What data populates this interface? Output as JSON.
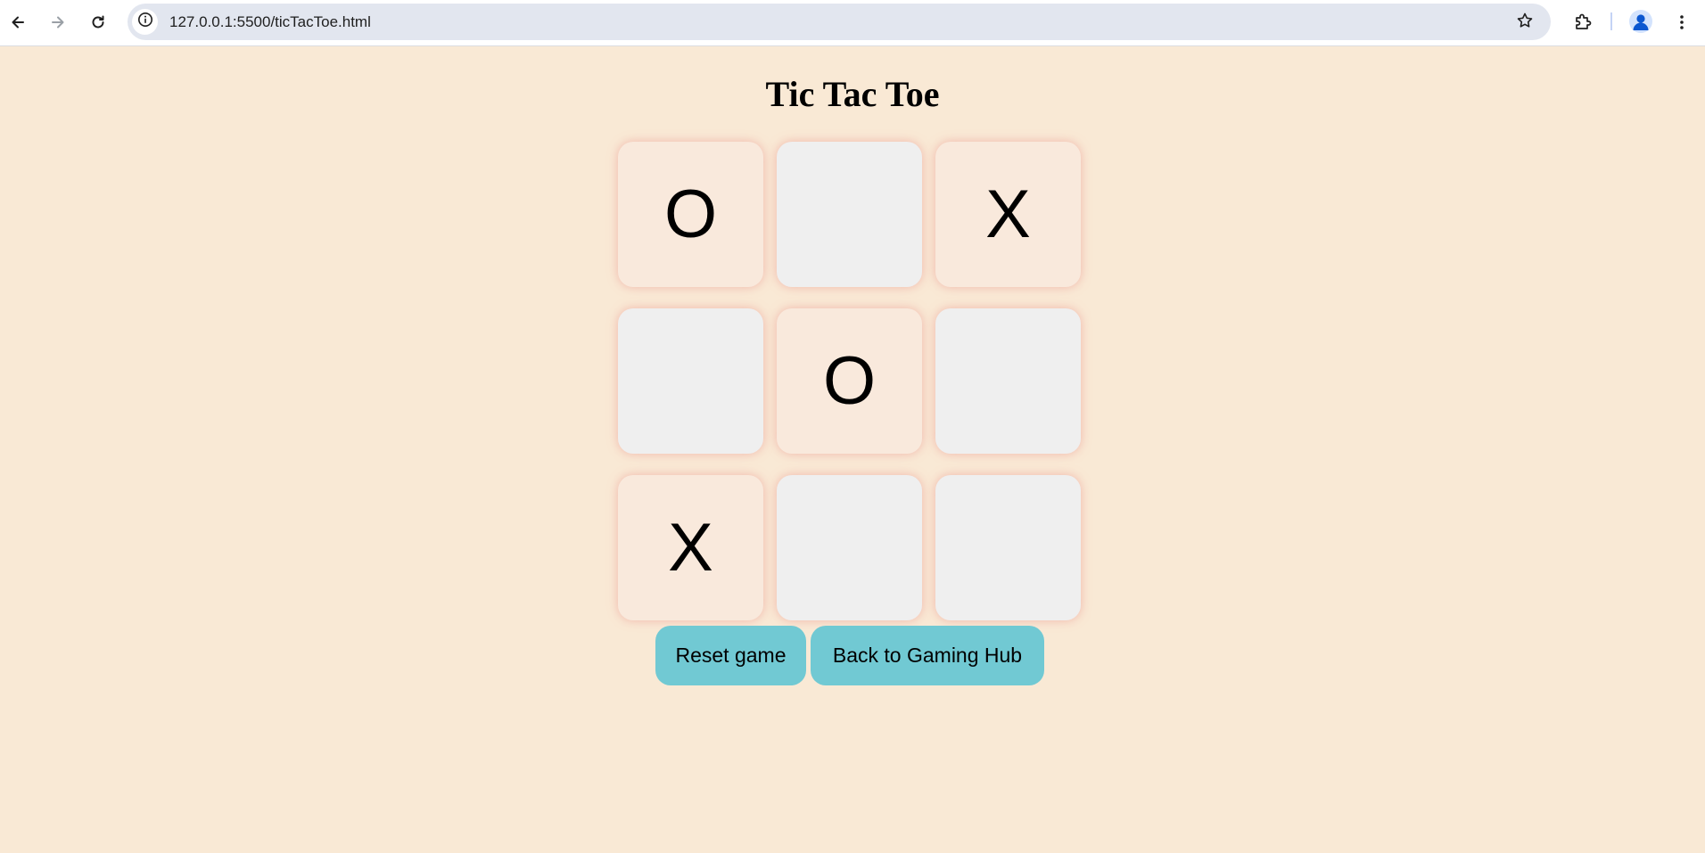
{
  "browser": {
    "url": "127.0.0.1:5500/ticTacToe.html",
    "icons": {
      "back": "arrow-left-icon",
      "forward": "arrow-right-icon",
      "reload": "reload-icon",
      "site_info": "info-icon",
      "bookmark": "star-icon",
      "extensions": "puzzle-icon",
      "profile": "person-icon",
      "menu": "kebab-menu-icon"
    }
  },
  "page": {
    "title": "Tic Tac Toe",
    "background_color": "#f9e9d5"
  },
  "board": {
    "cells": [
      "O",
      "",
      "X",
      "",
      "O",
      "",
      "X",
      "",
      ""
    ],
    "filled_cell_color": "#f9e9dc",
    "empty_cell_color": "#efefef",
    "glow_color": "#eb8c87"
  },
  "buttons": {
    "reset_label": "Reset game",
    "hub_label": "Back to Gaming Hub",
    "color": "#71c9d3"
  }
}
